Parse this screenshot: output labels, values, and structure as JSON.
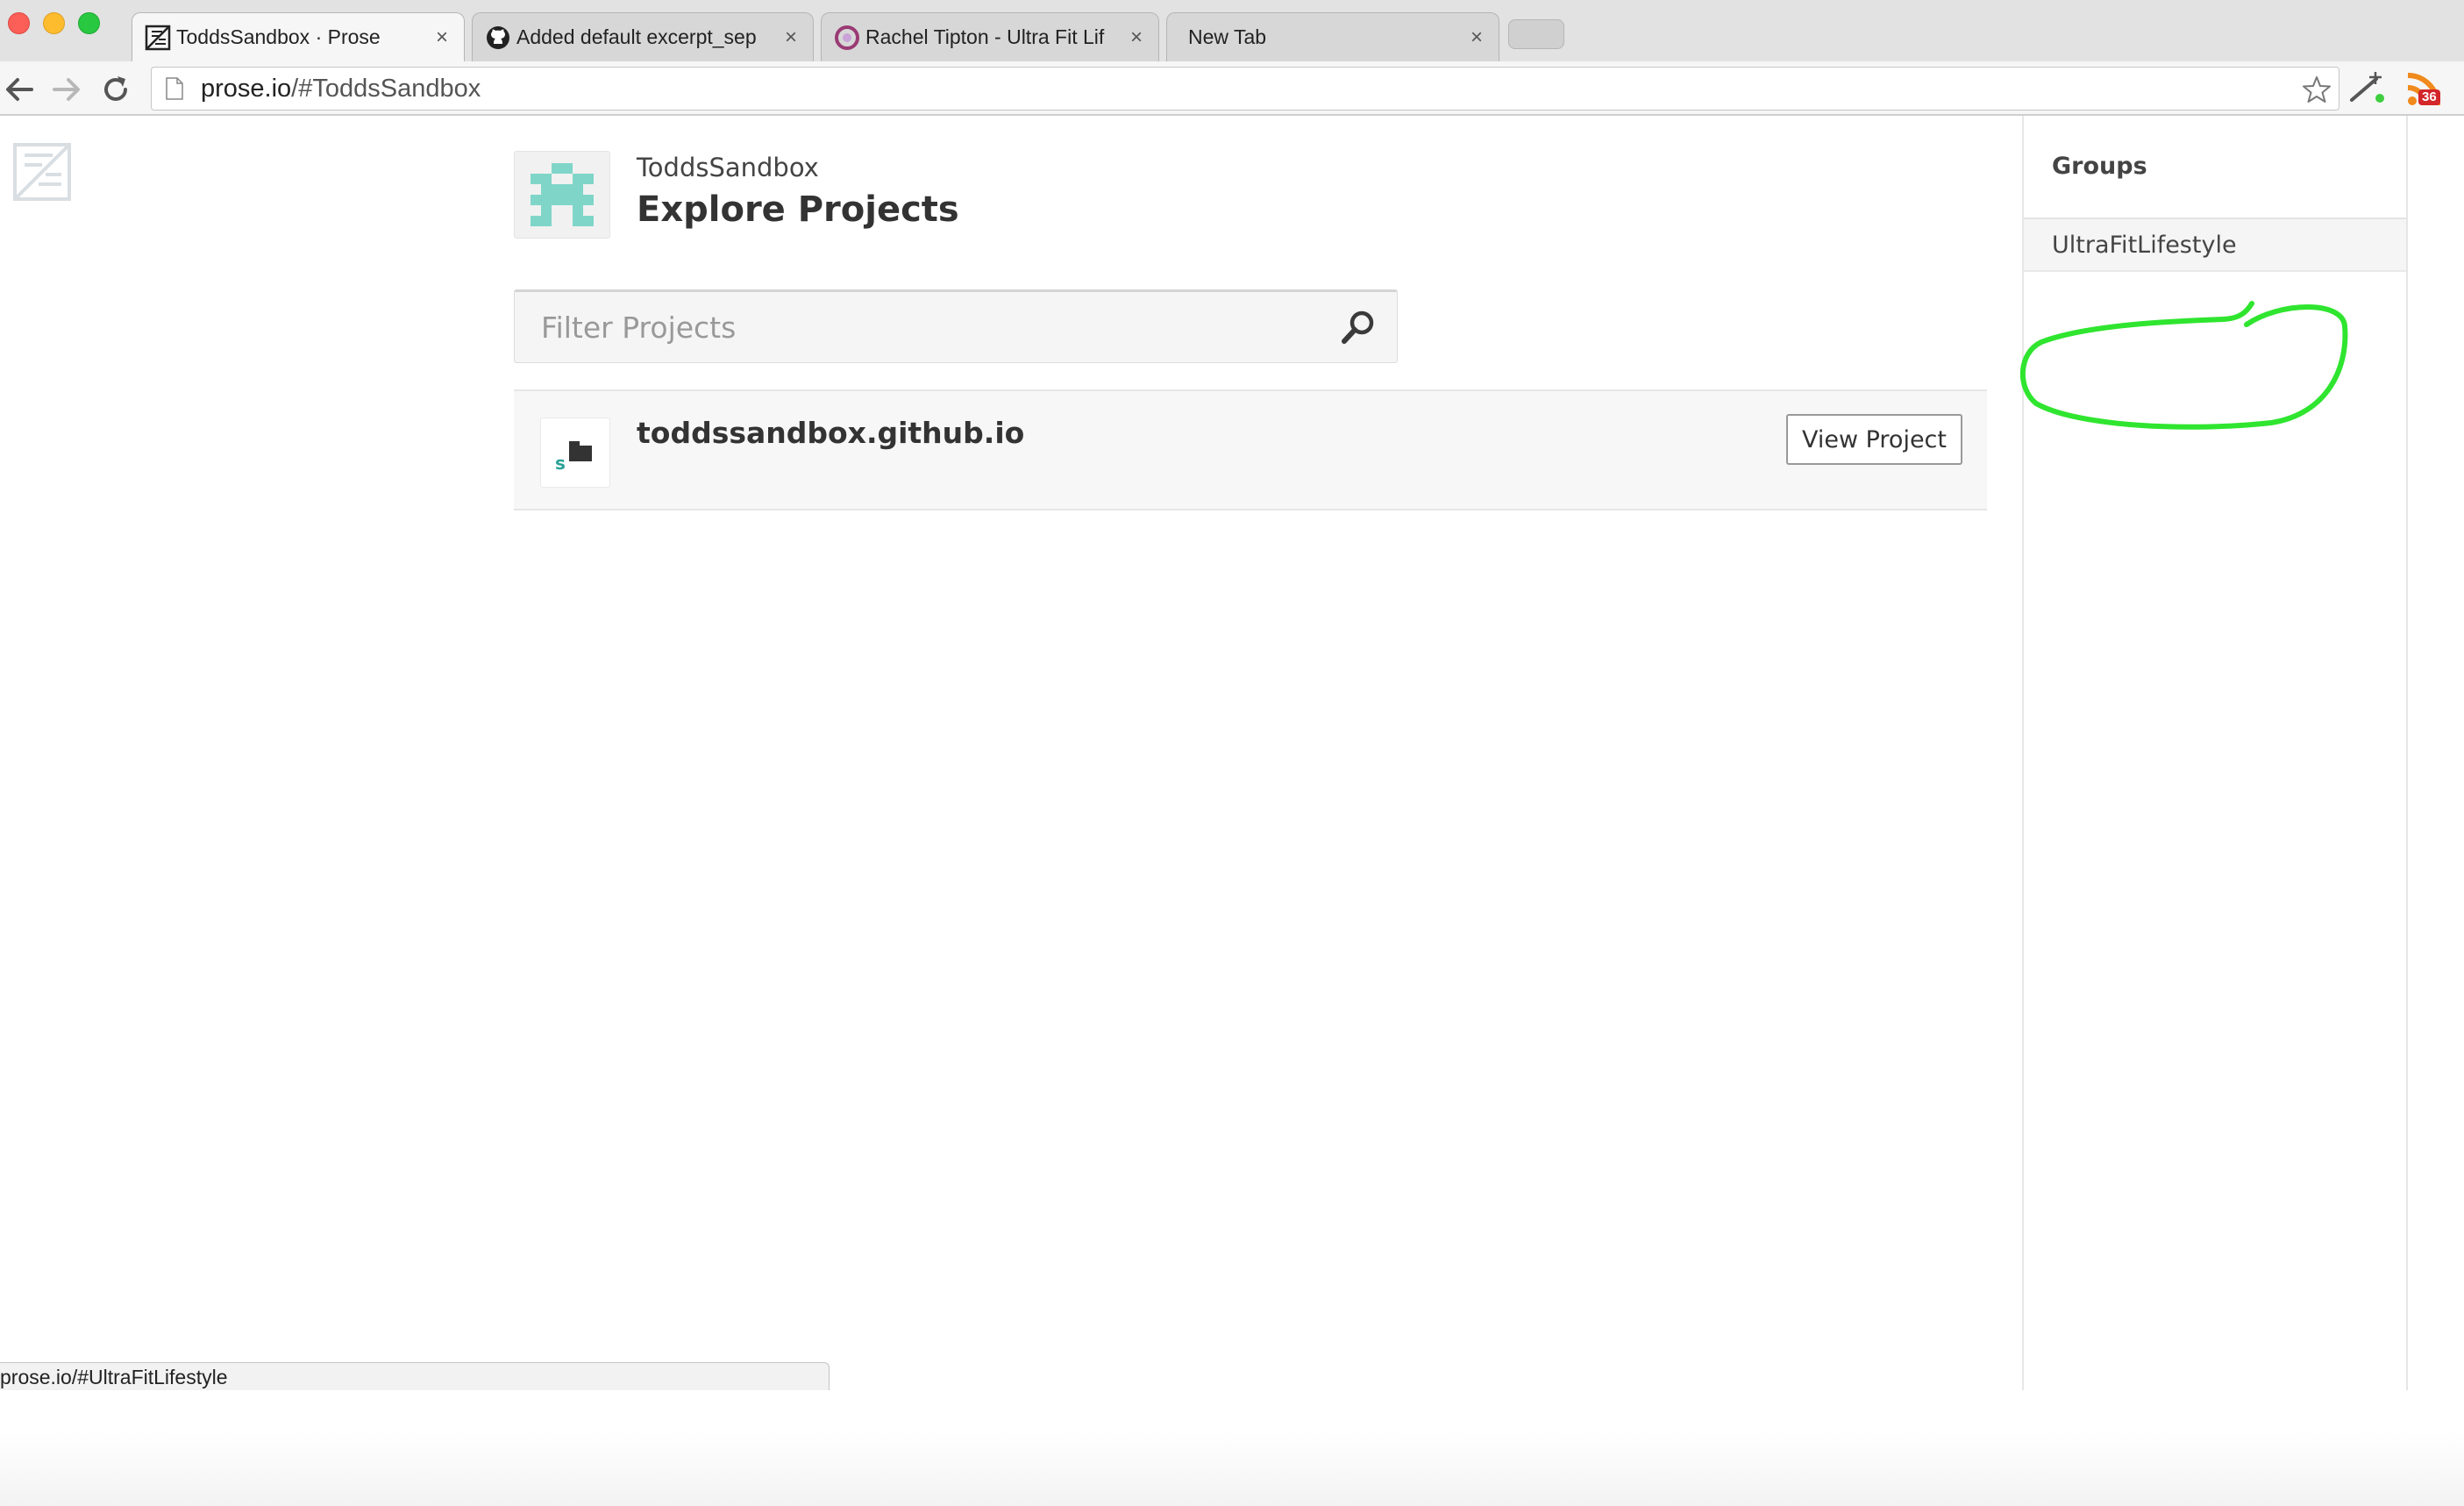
{
  "browser": {
    "tabs": [
      {
        "title": "ToddsSandbox · Prose",
        "icon": "prose-icon",
        "active": true
      },
      {
        "title": "Added default excerpt_sep",
        "icon": "github-icon",
        "active": false
      },
      {
        "title": "Rachel Tipton - Ultra Fit Lif",
        "icon": "site-icon",
        "active": false
      },
      {
        "title": "New Tab",
        "icon": "",
        "active": false
      }
    ],
    "close_glyph": "×",
    "address": {
      "host": "prose.io",
      "path": "/#ToddsSandbox"
    },
    "rss_badge": "36"
  },
  "header": {
    "account_name": "ToddsSandbox",
    "title": "Explore Projects"
  },
  "filter": {
    "placeholder": "Filter Projects"
  },
  "projects": [
    {
      "name": "toddssandbox.github.io",
      "action": "View Project"
    }
  ],
  "sidebar": {
    "heading": "Groups",
    "groups": [
      "UltraFitLifestyle"
    ]
  },
  "status_bar": {
    "url": "prose.io/#UltraFitLifestyle"
  },
  "colors": {
    "accent_teal": "#7fd6c8",
    "annotation_green": "#2fe52f",
    "traffic_red": "#fc5f57",
    "traffic_yellow": "#fdbc2e",
    "traffic_green": "#28c840"
  }
}
